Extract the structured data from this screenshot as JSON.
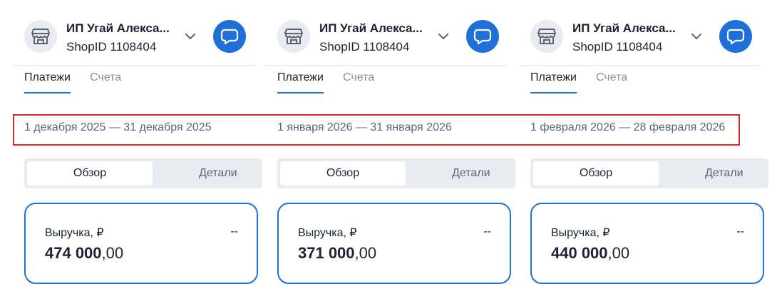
{
  "colors": {
    "accent": "#1e70d8",
    "highlight_border": "#d42a2a",
    "muted_text": "#8b919c",
    "segment_bg": "#e8ebf1"
  },
  "panels": [
    {
      "shop_name": "ИП Угай Алекса...",
      "shop_id": "ShopID 1108404",
      "tabs": [
        {
          "label": "Платежи"
        },
        {
          "label": "Счета"
        }
      ],
      "date_range": "1 декабря 2025 — 31 декабря 2025",
      "segment": {
        "active": "Обзор",
        "inactive": "Детали"
      },
      "card": {
        "label": "Выручка, ₽",
        "dash": "--",
        "amount_int": "474 000",
        "amount_dec": ",00"
      }
    },
    {
      "shop_name": "ИП Угай Алекса...",
      "shop_id": "ShopID 1108404",
      "tabs": [
        {
          "label": "Платежи"
        },
        {
          "label": "Счета"
        }
      ],
      "date_range": "1 января 2026 — 31 января 2026",
      "segment": {
        "active": "Обзор",
        "inactive": "Детали"
      },
      "card": {
        "label": "Выручка, ₽",
        "dash": "--",
        "amount_int": "371 000",
        "amount_dec": ",00"
      }
    },
    {
      "shop_name": "ИП Угай Алекса...",
      "shop_id": "ShopID 1108404",
      "tabs": [
        {
          "label": "Платежи"
        },
        {
          "label": "Счета"
        }
      ],
      "date_range": "1 февраля 2026 — 28 февраля 2026",
      "segment": {
        "active": "Обзор",
        "inactive": "Детали"
      },
      "card": {
        "label": "Выручка, ₽",
        "dash": "--",
        "amount_int": "440 000",
        "amount_dec": ",00"
      }
    }
  ],
  "icons": {
    "shop": "storefront-icon",
    "chevron": "chevron-down-icon",
    "chat": "chat-bubble-icon"
  }
}
